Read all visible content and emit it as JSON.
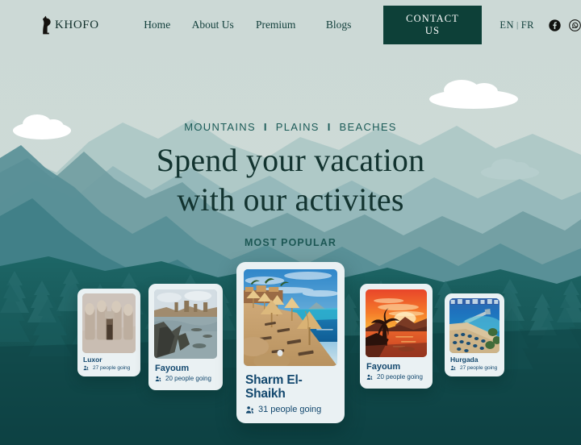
{
  "brand": {
    "name": "KHOFO",
    "logo_icon": "cat-silhouette-icon"
  },
  "nav": {
    "links": [
      {
        "label": "Home"
      },
      {
        "label": "About Us"
      },
      {
        "label": "Premium"
      },
      {
        "label": "Blogs"
      }
    ],
    "contact_label": "CONTACT US",
    "lang": {
      "current": "EN",
      "separator": "|",
      "alternate": "FR"
    },
    "social": [
      {
        "name": "facebook-icon"
      },
      {
        "name": "whatsapp-icon"
      }
    ]
  },
  "hero": {
    "eyebrow": [
      "MOUNTAINS",
      "PLAINS",
      "BEACHES"
    ],
    "eyebrow_separator": "I",
    "headline_line1": "Spend your vacation",
    "headline_line2": "with our activites"
  },
  "section": {
    "most_popular": "MOST POPULAR"
  },
  "cards": [
    {
      "id": "luxor",
      "title": "Luxor",
      "going": "27 people going",
      "people_icon": "people-icon"
    },
    {
      "id": "fayoum1",
      "title": "Fayoum",
      "going": "20 people going",
      "people_icon": "people-icon"
    },
    {
      "id": "sharm",
      "title": "Sharm El-Shaikh",
      "going": "31 people going",
      "people_icon": "people-icon"
    },
    {
      "id": "fayoum2",
      "title": "Fayoum",
      "going": "20 people going",
      "people_icon": "people-icon"
    },
    {
      "id": "hurgada",
      "title": "Hurgada",
      "going": "27 people going",
      "people_icon": "people-icon"
    }
  ],
  "colors": {
    "sky": "#ccd9d6",
    "accent_dark_green": "#0d4038",
    "heading": "#12332f",
    "eyebrow": "#1b5b57",
    "card_bg": "#eaf1f3",
    "card_text": "#13486e",
    "foreground_forest": "#0f4a4a"
  }
}
